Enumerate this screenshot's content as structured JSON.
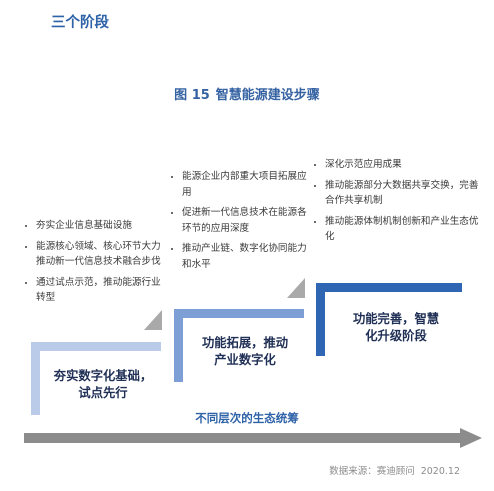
{
  "section_title": "三个阶段",
  "figure": {
    "number": "图 15",
    "title": "智慧能源建设步骤"
  },
  "stages": [
    {
      "label_lines": [
        "夯实数字化基础，",
        "试点先行"
      ],
      "color": "#b9cbe9",
      "bullets": [
        "夯实企业信息基础设施",
        "能源核心领域、核心环节大力推动新一代信息技术融合步伐",
        "通过试点示范，推动能源行业转型"
      ]
    },
    {
      "label_lines": [
        "功能拓展，推动",
        "产业数字化"
      ],
      "color": "#7e9fd6",
      "bullets": [
        "能源企业内部重大项目拓展应用",
        "促进新一代信息技术在能源各环节的应用深度",
        "推动产业链、数字化协同能力和水平"
      ]
    },
    {
      "label_lines": [
        "功能完善，智慧",
        "化升级阶段"
      ],
      "color": "#2f66b3",
      "bullets": [
        "深化示范应用成果",
        "推动能源部分大数据共享交换，完善合作共享机制",
        "推动能源体制机制创新和产业生态优化"
      ]
    }
  ],
  "eco_label": "不同层次的生态统筹",
  "source": {
    "prefix": "数据来源：赛迪顾问",
    "date": "2020.12"
  },
  "colors": {
    "title_blue": "#2f63a8",
    "arrow_gray": "#8c8c8c",
    "fold_gray": "#a9a9a9"
  }
}
